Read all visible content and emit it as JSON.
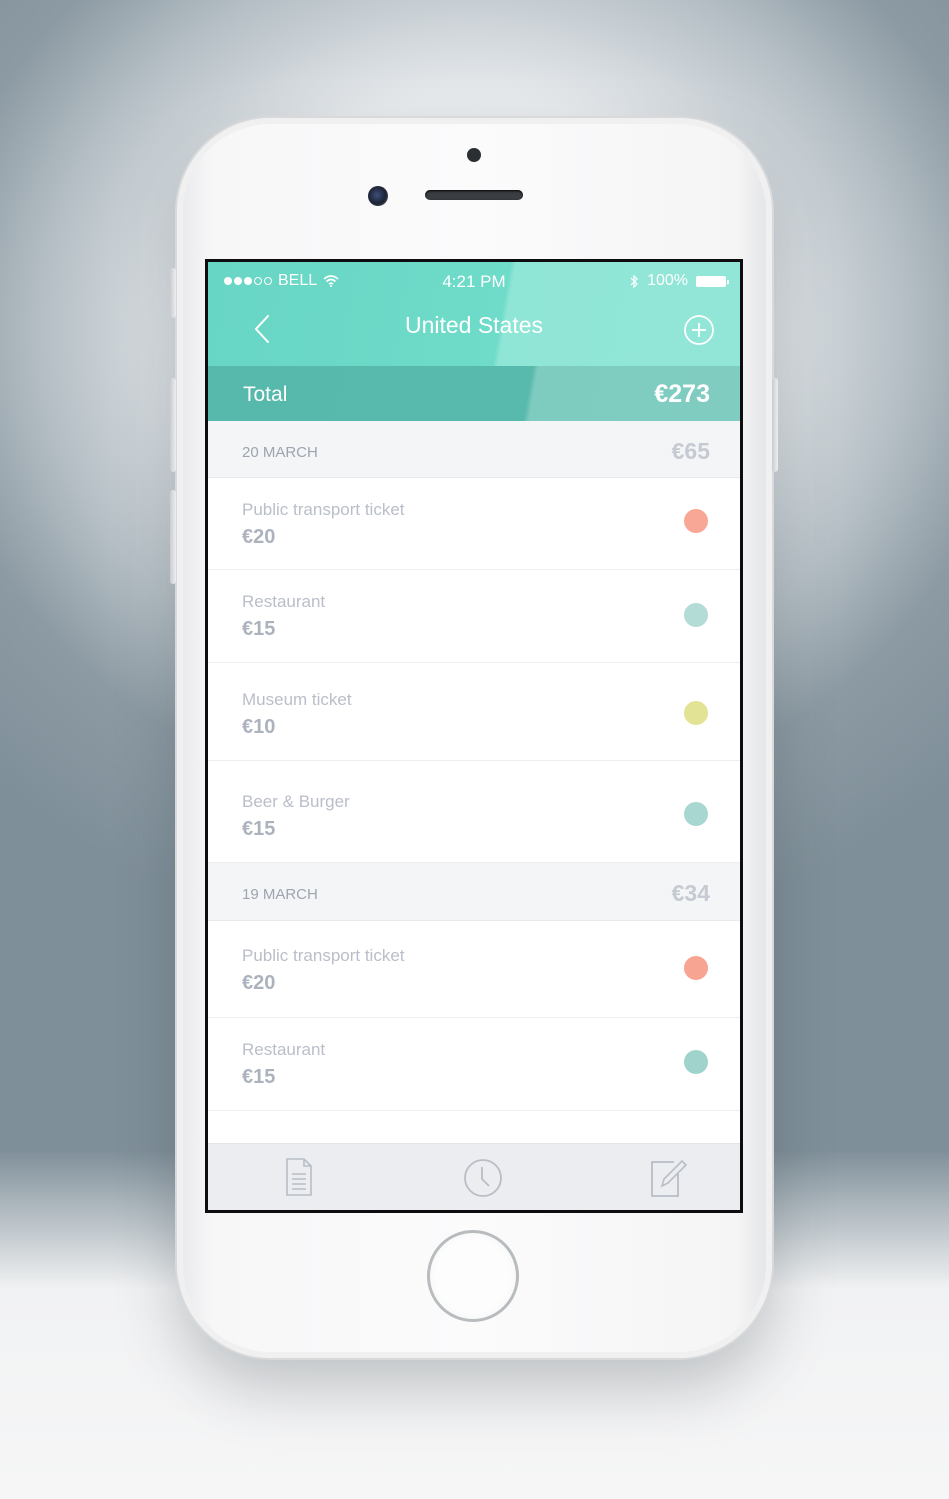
{
  "status_bar": {
    "carrier": "BELL",
    "time": "4:21 PM",
    "battery": "100%"
  },
  "nav": {
    "title": "United States",
    "back_icon": "chevron-left-icon",
    "add_icon": "plus-circle-icon"
  },
  "total": {
    "label": "Total",
    "value": "€273"
  },
  "sections": [
    {
      "date": "20 MARCH",
      "total": "€65",
      "items": [
        {
          "title": "Public transport ticket",
          "amount": "€20",
          "color": "#f8a696"
        },
        {
          "title": "Restaurant",
          "amount": "€15",
          "color": "#b3dcd6"
        },
        {
          "title": "Museum ticket",
          "amount": "€10",
          "color": "#e2e394"
        },
        {
          "title": "Beer & Burger",
          "amount": "€15",
          "color": "#a7d7d0"
        }
      ]
    },
    {
      "date": "19 MARCH",
      "total": "€34",
      "items": [
        {
          "title": "Public transport ticket",
          "amount": "€20",
          "color": "#f8a493"
        },
        {
          "title": "Restaurant",
          "amount": "€15",
          "color": "#9fd3cb"
        }
      ]
    }
  ],
  "tabs": [
    {
      "icon": "document-icon"
    },
    {
      "icon": "clock-icon"
    },
    {
      "icon": "edit-icon"
    }
  ],
  "colors": {
    "header": "#6fdbc9",
    "total_bar": "#58baac",
    "section_bg": "#f4f5f7",
    "text_muted": "#b9bec8"
  }
}
